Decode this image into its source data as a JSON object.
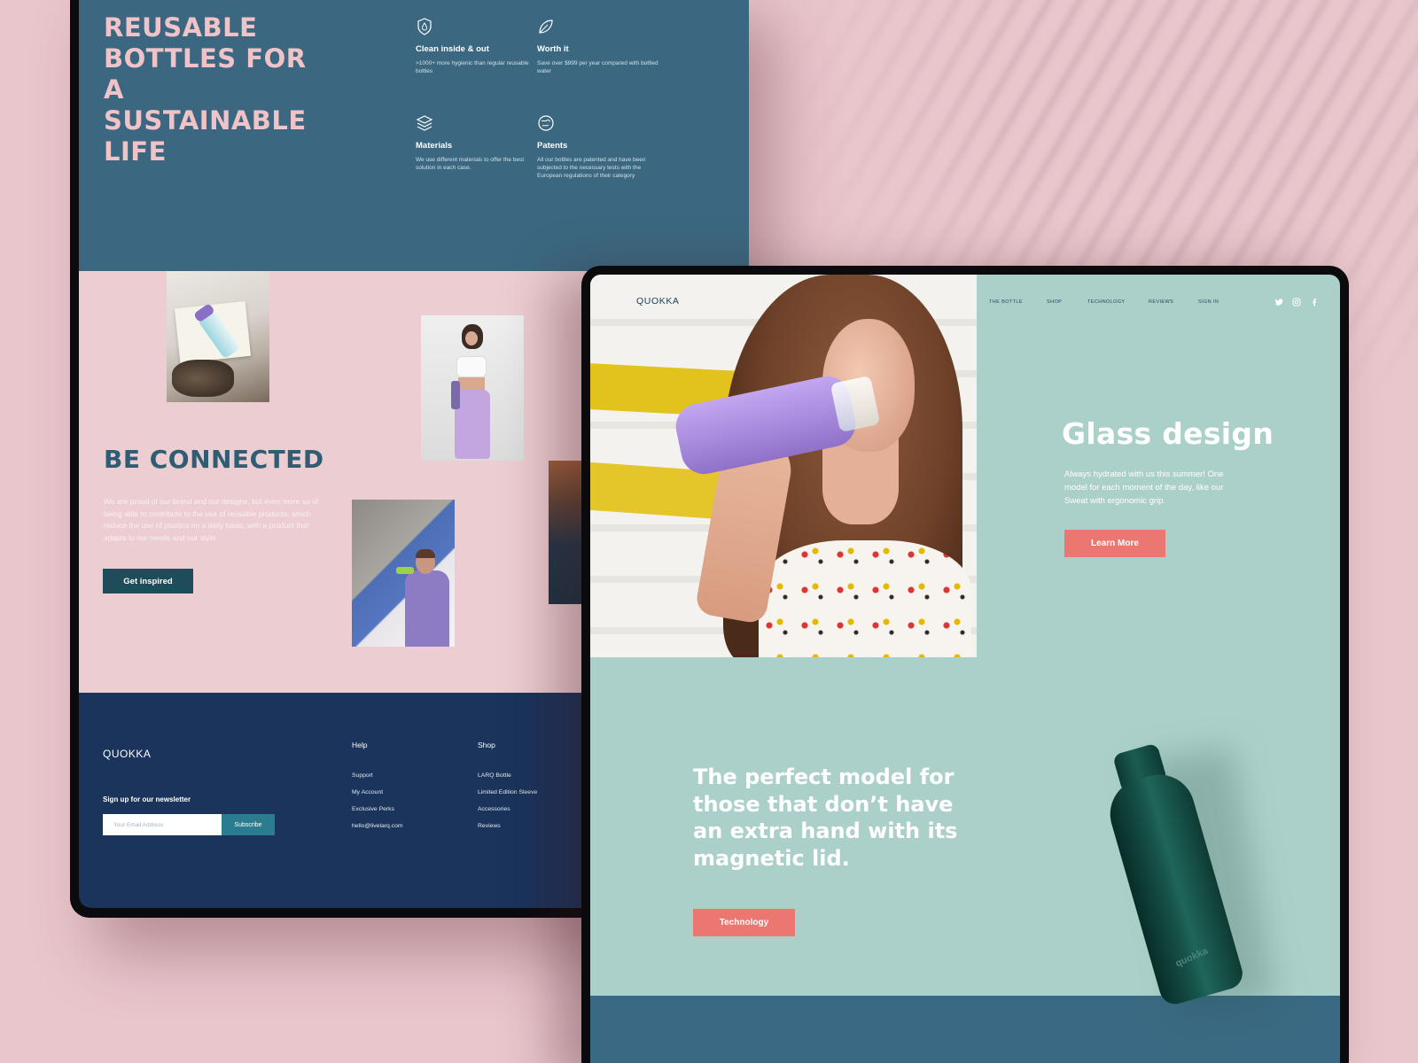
{
  "back_page": {
    "hero": {
      "title": "REUSABLE BOTTLES FOR A SUSTAINABLE LIFE",
      "features": [
        {
          "icon": "shield-drop-icon",
          "title": "Clean inside & out",
          "desc": ">1000+ more hygienic than regular reusable bottles"
        },
        {
          "icon": "leaf-icon",
          "title": "Worth it",
          "desc": "Save over $999 per year compared with bottled water"
        },
        {
          "icon": "layers-icon",
          "title": "Materials",
          "desc": "We use different materials to offer the best solution in each case."
        },
        {
          "icon": "globe-icon",
          "title": "Patents",
          "desc": "All our bottles are patented and have been subjected to the necessary tests with the European regulations of their category"
        }
      ]
    },
    "connected": {
      "heading": "BE CONNECTED",
      "paragraph": "We are proud of our brand and our designs, but even more so of being able to contribute to the use of reusable products, which reduce the use of plastics on a daily basis, with a product that adapts to our needs and our style.",
      "button": "Get inspired"
    },
    "footer": {
      "logo": "QUOKKA",
      "newsletter_label": "Sign up for our newsletter",
      "email_placeholder": "Your Email Address",
      "subscribe": "Subscribe",
      "help": {
        "heading": "Help",
        "links": [
          "Support",
          "My Account",
          "Exclusive Perks",
          "hello@livelarq.com"
        ]
      },
      "shop": {
        "heading": "Shop",
        "links": [
          "LARQ Bottle",
          "Limited Edition Sleeve",
          "Accessories",
          "Reviews"
        ]
      }
    }
  },
  "front_page": {
    "logo": "QUOKKA",
    "nav": [
      "THE BOTTLE",
      "SHOP",
      "TECHNOLOGY",
      "REVIEWS",
      "SIGN IN"
    ],
    "social": [
      "twitter-icon",
      "instagram-icon",
      "facebook-icon"
    ],
    "hero": {
      "title": "Glass design",
      "text": "Always hydrated with us this summer! One model for each moment of the day, like our Sweat with ergonomic grip.",
      "button": "Learn More"
    },
    "feature": {
      "title": "The perfect model for those that don’t have an extra hand with its magnetic lid.",
      "button": "Technology",
      "bottle_brand": "quokka"
    }
  },
  "colors": {
    "wall": "#e9c6cc",
    "back_top": "#3b6880",
    "back_mid": "#eccdd1",
    "back_footer": "#1a345b",
    "front_bg": "#abd0ca",
    "accent": "#ec7670",
    "dark_teal_button": "#1e4d59",
    "pink_heading": "#f0c3c8"
  }
}
